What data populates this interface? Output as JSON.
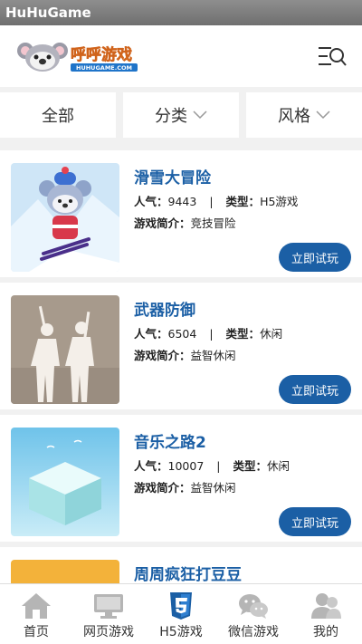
{
  "statusbar": {
    "app_name": "HuHuGame"
  },
  "header": {
    "logo_text": "呼呼游戏",
    "logo_sub": "HUHUGAME.COM"
  },
  "filters": [
    {
      "label": "全部"
    },
    {
      "label": "分类"
    },
    {
      "label": "风格"
    }
  ],
  "labels": {
    "popularity": "人气：",
    "type": "类型：",
    "intro": "游戏简介：",
    "play": "立即试玩"
  },
  "games": [
    {
      "title": "滑雪大冒险",
      "popularity": "9443",
      "type": "H5游戏",
      "intro": "竞技冒险"
    },
    {
      "title": "武器防御",
      "popularity": "6504",
      "type": "休闲",
      "intro": "益智休闲"
    },
    {
      "title": "音乐之路2",
      "popularity": "10007",
      "type": "休闲",
      "intro": "益智休闲"
    },
    {
      "title": "周周疯狂打豆豆",
      "popularity": "",
      "type": "",
      "intro": ""
    }
  ],
  "tabs": [
    {
      "label": "首页",
      "icon": "home-icon"
    },
    {
      "label": "网页游戏",
      "icon": "monitor-icon"
    },
    {
      "label": "H5游戏",
      "icon": "html5-icon"
    },
    {
      "label": "微信游戏",
      "icon": "wechat-icon"
    },
    {
      "label": "我的",
      "icon": "user-icon"
    }
  ],
  "colors": {
    "accent": "#1b5fa5",
    "active_tab": "#1b5fa5",
    "inactive_icon": "#b5b5b5"
  }
}
